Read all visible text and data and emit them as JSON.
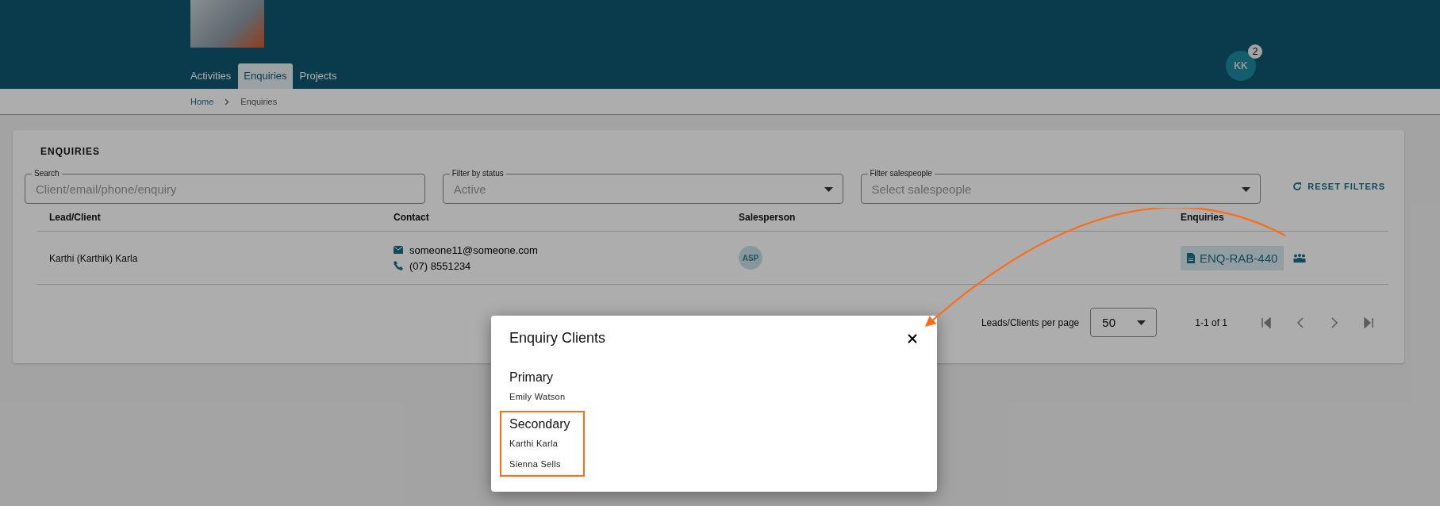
{
  "header": {
    "tabs": [
      {
        "label": "Activities",
        "selected": false
      },
      {
        "label": "Enquiries",
        "selected": true
      },
      {
        "label": "Projects",
        "selected": false
      }
    ],
    "user": {
      "initials": "KK",
      "badge": "2"
    }
  },
  "breadcrumb": [
    {
      "label": "Home",
      "kind": "link"
    },
    {
      "label": "Enquiries",
      "kind": "current"
    }
  ],
  "card": {
    "title": "ENQUIRIES",
    "filters": [
      {
        "kind": "text",
        "label": "Search",
        "placeholder": "Client/email/phone/enquiry"
      },
      {
        "kind": "select",
        "label": "Filter by status",
        "value": "Active"
      },
      {
        "kind": "select",
        "label": "Filter salespeople",
        "placeholder": "Select salespeople"
      }
    ],
    "reset_button": "RESET FILTERS",
    "table": {
      "columns": [
        "Lead/Client",
        "Contact",
        "Salesperson",
        "Enquiries"
      ],
      "rows": [
        {
          "lead": "Karthi (Karthik) Karla",
          "email": "someone11@someone.com",
          "phone": "(07) 8551234",
          "salesperson": "ASP",
          "enquiry": "ENQ-RAB-440"
        }
      ]
    },
    "pagination": {
      "per_page_label": "Leads/Clients per page",
      "per_page": "50",
      "range": "1-1 of 1"
    }
  },
  "modal": {
    "title": "Enquiry Clients",
    "sections": [
      {
        "heading": "Primary",
        "names": [
          "Emily Watson"
        ],
        "highlighted": false
      },
      {
        "heading": "Secondary",
        "names": [
          "Karthi Karla",
          "Sienna Sells"
        ],
        "highlighted": true
      }
    ]
  }
}
